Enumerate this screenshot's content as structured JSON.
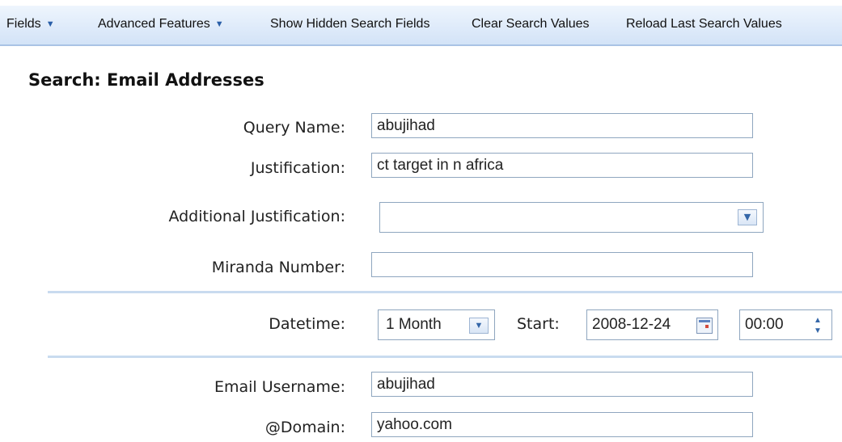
{
  "toolbar": {
    "fields": "Fields",
    "advanced": "Advanced Features",
    "show_hidden": "Show Hidden Search Fields",
    "clear": "Clear Search Values",
    "reload": "Reload Last Search Values"
  },
  "panel": {
    "title": "Search: Email Addresses"
  },
  "form": {
    "query_name": {
      "label": "Query Name:",
      "value": "abujihad"
    },
    "justification": {
      "label": "Justification:",
      "value": "ct target in n africa"
    },
    "additional_justification": {
      "label": "Additional Justification:",
      "value": ""
    },
    "miranda_number": {
      "label": "Miranda Number:",
      "value": ""
    },
    "datetime": {
      "label": "Datetime:",
      "range": "1 Month",
      "start_label": "Start:",
      "start_date": "2008-12-24",
      "start_time": "00:00"
    },
    "email_username": {
      "label": "Email Username:",
      "value": "abujihad"
    },
    "domain": {
      "label": "@Domain:",
      "value": "yahoo.com"
    }
  },
  "icons": {
    "dropdown": "chevron-down-icon",
    "calendar": "calendar-icon",
    "spinner": "spinner-icon"
  },
  "colors": {
    "toolbar_bg": "#dfebfa",
    "caret": "#2a5fa8",
    "separator": "#c9dbef",
    "field_border": "#8fa6bf"
  }
}
